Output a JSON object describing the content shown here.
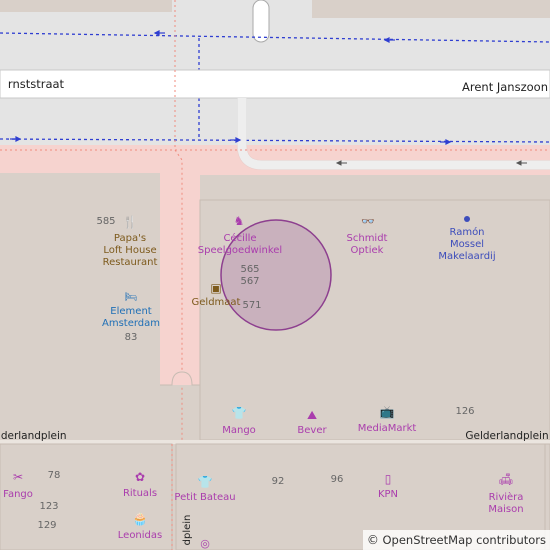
{
  "streets": {
    "north_left": "rnststraat",
    "north_right": "Arent Janszoon",
    "plein_left": "elderlandplein",
    "plein_right": "Gelderlandplein",
    "vertical": "dplein"
  },
  "pois": {
    "papas": "Papa's\nLoft House\nRestaurant",
    "cecille": "Cécille\nSpeelgoedwinkel",
    "schmidt": "Schmidt\nOptiek",
    "ramon": "Ramón\nMossel\nMakelaardij",
    "geldmaat": "Geldmaat",
    "element": "Element\nAmsterdam",
    "mango": "Mango",
    "bever": "Bever",
    "mediamarkt": "MediaMarkt",
    "fango": "Fango",
    "rituals": "Rituals",
    "petit_bateau": "Petit Bateau",
    "kpn": "KPN",
    "riviera": "Rivièra\nMaison",
    "leonidas": "Leonidas"
  },
  "house_numbers": {
    "n585": "585",
    "n565": "565",
    "n567": "567",
    "n571": "571",
    "n83": "83",
    "n126": "126",
    "n78": "78",
    "n123": "123",
    "n129": "129",
    "n92": "92",
    "n96": "96"
  },
  "attribution": {
    "symbol": "©",
    "text": "OpenStreetMap contributors"
  },
  "icons": [
    "restaurant-icon",
    "toy-horse-icon",
    "glasses-icon",
    "dot-icon",
    "atm-icon",
    "hotel-icon",
    "shirt-icon",
    "hiker-icon",
    "tv-icon",
    "beauty-icon",
    "perfume-icon",
    "phone-icon",
    "sofa-icon",
    "cake-icon"
  ],
  "colors": {
    "background": "#d9d0c9",
    "road": "#ffffff",
    "pedestrian": "#f6d3cf",
    "building": "#ccc3bc",
    "marker": "#b58bb0"
  }
}
